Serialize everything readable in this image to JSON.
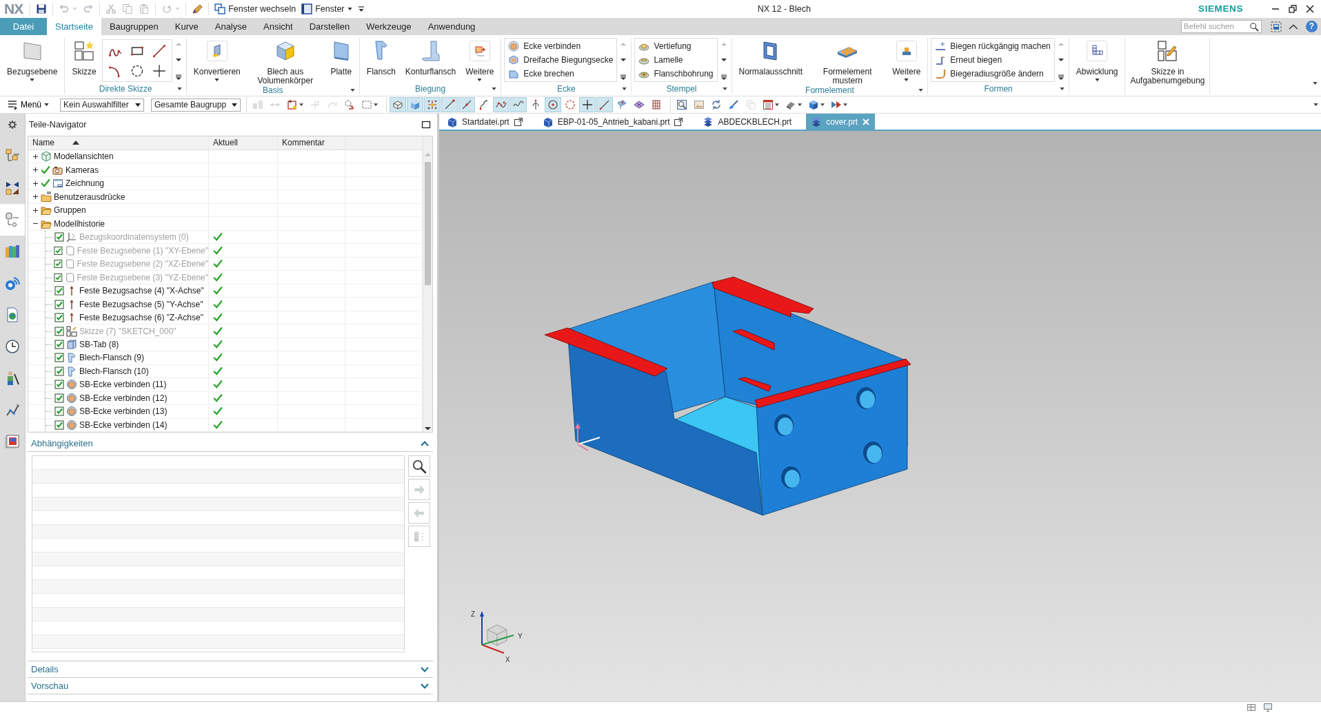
{
  "title_bar": {
    "logo": "NX",
    "quick_access": [
      [
        {
          "kind": "save",
          "disabled": false
        }
      ],
      [
        {
          "kind": "undo",
          "disabled": true,
          "dropdown": true
        },
        {
          "kind": "redo",
          "disabled": true
        }
      ],
      [
        {
          "kind": "cut",
          "disabled": true
        },
        {
          "kind": "copy",
          "disabled": true
        },
        {
          "kind": "paste",
          "disabled": true
        }
      ],
      [
        {
          "kind": "repeat",
          "disabled": true,
          "dropdown": true
        }
      ],
      [
        {
          "kind": "touch",
          "disabled": false
        }
      ],
      [
        {
          "kind": "switch-window",
          "disabled": false,
          "label": "Fenster wechseln"
        },
        {
          "kind": "window",
          "disabled": false,
          "label": "Fenster",
          "dropdown": true
        },
        {
          "kind": "customize",
          "disabled": false
        }
      ]
    ],
    "title": "NX 12 - Blech",
    "brand": "SIEMENS"
  },
  "menu_tabs": {
    "file_tab": "Datei",
    "tabs": [
      {
        "label": "Startseite",
        "selected": true
      },
      {
        "label": "Baugruppen",
        "selected": false
      },
      {
        "label": "Kurve",
        "selected": false
      },
      {
        "label": "Analyse",
        "selected": false
      },
      {
        "label": "Ansicht",
        "selected": false
      },
      {
        "label": "Darstellen",
        "selected": false
      },
      {
        "label": "Werkzeuge",
        "selected": false
      },
      {
        "label": "Anwendung",
        "selected": false
      }
    ],
    "command_search": {
      "placeholder": "Befehl suchen"
    },
    "help": "?"
  },
  "ribbon": [
    {
      "buttons": [
        {
          "kind": "datum-plane",
          "label": "Bezugsebene",
          "dropdown": true
        }
      ]
    },
    {
      "label": "Direkte Skizze",
      "options_menu": true,
      "buttons": [
        {
          "kind": "sketch",
          "label": "Skizze"
        }
      ],
      "sketch_tools": [
        {
          "kind": "spline"
        },
        {
          "kind": "rectangle"
        },
        {
          "kind": "straight-line"
        },
        {
          "kind": "arc"
        },
        {
          "kind": "circle"
        },
        {
          "kind": "point"
        }
      ]
    },
    {
      "label": "Basis",
      "options_menu": true,
      "buttons": [
        {
          "kind": "convert",
          "label": "Konvertieren",
          "dropdown": true
        },
        {
          "kind": "solid-to-sheet",
          "label": "Blech aus Volumenkörper"
        },
        {
          "kind": "plate",
          "label": "Platte"
        }
      ]
    },
    {
      "label": "Biegung",
      "options_menu": true,
      "buttons": [
        {
          "kind": "flange",
          "label": "Flansch"
        },
        {
          "kind": "contour-flange",
          "label": "Konturflansch"
        },
        {
          "kind": "bend-gallery",
          "label": "Weitere",
          "dropdown": true
        }
      ]
    },
    {
      "label": "Ecke",
      "options_menu": true,
      "entries": [
        {
          "kind": "closed-corner",
          "label": "Ecke verbinden"
        },
        {
          "kind": "three-bend-corner",
          "label": "Dreifache Biegungsecke"
        },
        {
          "kind": "break-corner",
          "label": "Ecke brechen"
        }
      ]
    },
    {
      "label": "Stempel",
      "options_menu": true,
      "entries": [
        {
          "kind": "dimple",
          "label": "Vertiefung"
        },
        {
          "kind": "louver",
          "label": "Lamelle"
        },
        {
          "kind": "drawn-cutout",
          "label": "Flanschbohrung"
        }
      ]
    },
    {
      "label": "Formelement",
      "options_menu": true,
      "buttons": [
        {
          "kind": "cutout",
          "label": "Normalausschnitt"
        },
        {
          "kind": "pattern",
          "label": "Formelement mustern"
        },
        {
          "kind": "feature-gallery",
          "label": "Weitere",
          "dropdown": true
        }
      ]
    },
    {
      "label": "Formen",
      "options_menu": true,
      "entries": [
        {
          "kind": "unbend",
          "label": "Biegen rückgängig machen"
        },
        {
          "kind": "rebend",
          "label": "Erneut biegen"
        },
        {
          "kind": "resize-radius",
          "label": "Biegeradiusgröße ändern"
        }
      ]
    },
    {
      "buttons": [
        {
          "kind": "flat-pattern",
          "label": "Abwicklung",
          "dropdown": true
        }
      ]
    },
    {
      "buttons": [
        {
          "kind": "sketch-in-task",
          "label": "Skizze in Aufgabenumgebung"
        }
      ]
    }
  ],
  "toolbar": {
    "menu": "Menü",
    "selection_filter": "Kein Auswahlfilter",
    "scope": "Gesamte Baugrupp",
    "tools": [
      [
        {
          "kind": "part-filter",
          "on": false,
          "disabled": true
        },
        {
          "kind": "pointer",
          "on": false,
          "disabled": true
        },
        {
          "kind": "color-select",
          "on": false,
          "disabled": false,
          "dropdown": true
        },
        {
          "kind": "snap-plus",
          "on": false,
          "disabled": true
        },
        {
          "kind": "curve-arrow",
          "on": false,
          "disabled": true
        },
        {
          "kind": "select-all",
          "on": false,
          "disabled": false
        },
        {
          "kind": "box-select",
          "on": false,
          "disabled": false,
          "dropdown": true
        }
      ],
      [
        {
          "kind": "view-outline",
          "on": true,
          "disabled": false
        },
        {
          "kind": "cube",
          "on": true,
          "disabled": false
        },
        {
          "kind": "snap-points",
          "on": true,
          "disabled": false
        },
        {
          "kind": "end-point",
          "on": true,
          "disabled": false
        },
        {
          "kind": "mid-point",
          "on": true,
          "disabled": false
        },
        {
          "kind": "curve-point",
          "on": false,
          "disabled": false
        },
        {
          "kind": "spline-points",
          "on": true,
          "disabled": false
        },
        {
          "kind": "wave",
          "on": true,
          "disabled": false
        },
        {
          "kind": "axis",
          "on": false,
          "disabled": false
        },
        {
          "kind": "center",
          "on": true,
          "disabled": false
        },
        {
          "kind": "quadrant",
          "on": false,
          "disabled": false
        },
        {
          "kind": "cross",
          "on": true,
          "disabled": false
        },
        {
          "kind": "line",
          "on": true,
          "disabled": false
        },
        {
          "kind": "face",
          "on": false,
          "disabled": false
        },
        {
          "kind": "mesh",
          "on": false,
          "disabled": false
        },
        {
          "kind": "grid",
          "on": false,
          "disabled": false
        }
      ],
      [
        {
          "kind": "zoom-window",
          "on": false,
          "disabled": false
        },
        {
          "kind": "image",
          "on": false,
          "disabled": false
        },
        {
          "kind": "rotate",
          "on": false,
          "disabled": false
        },
        {
          "kind": "brush",
          "on": false,
          "disabled": false
        },
        {
          "kind": "layers",
          "on": false,
          "disabled": true
        },
        {
          "kind": "layout",
          "on": false,
          "disabled": false,
          "dropdown": true
        },
        {
          "kind": "shade",
          "on": false,
          "disabled": false,
          "dropdown": true
        },
        {
          "kind": "solid",
          "on": false,
          "disabled": false,
          "dropdown": true
        },
        {
          "kind": "views",
          "on": false,
          "disabled": false,
          "dropdown": true
        }
      ]
    ]
  },
  "resource_bar": [
    {
      "kind": "settings",
      "selected": false
    },
    {
      "kind": "assembly-navigator",
      "selected": false
    },
    {
      "kind": "constraint-navigator",
      "selected": false
    },
    {
      "kind": "part-navigator",
      "selected": true
    },
    {
      "kind": "reuse-library",
      "selected": false
    },
    {
      "kind": "hd3d",
      "selected": false
    },
    {
      "kind": "web-browser",
      "selected": false
    },
    {
      "kind": "history",
      "selected": false
    },
    {
      "kind": "roles",
      "selected": false
    },
    {
      "kind": "process-studio",
      "selected": false
    },
    {
      "kind": "visualization",
      "selected": false
    }
  ],
  "navigator": {
    "title": "Teile-Navigator",
    "columns": [
      {
        "label": "Name",
        "sorted": true
      },
      {
        "label": "Aktuell",
        "sorted": false
      },
      {
        "label": "Kommentar",
        "sorted": false
      }
    ],
    "tree": [
      {
        "label": "Modellansichten",
        "kind": "views",
        "expanded": false,
        "checked": false
      },
      {
        "label": "Kameras",
        "kind": "cameras",
        "expanded": false,
        "checked": true
      },
      {
        "label": "Zeichnung",
        "kind": "drawing",
        "expanded": false,
        "checked": true
      },
      {
        "label": "Benutzerausdrücke",
        "kind": "expressions",
        "expanded": false,
        "checked": false
      },
      {
        "label": "Gruppen",
        "kind": "folder",
        "expanded": false,
        "checked": false
      },
      {
        "label": "Modellhistorie",
        "kind": "folder",
        "expanded": true,
        "checked": false,
        "children": [
          {
            "label": "Bezugskoordinatensystem (0)",
            "kind": "csys",
            "checked": true,
            "dimmed": true,
            "current": true
          },
          {
            "label": "Feste Bezugsebene (1) \"XY-Ebene\"",
            "kind": "plane",
            "checked": true,
            "dimmed": true,
            "current": true
          },
          {
            "label": "Feste Bezugsebene (2) \"XZ-Ebene\"",
            "kind": "plane",
            "checked": true,
            "dimmed": true,
            "current": true
          },
          {
            "label": "Feste Bezugsebene (3) \"YZ-Ebene\"",
            "kind": "plane",
            "checked": true,
            "dimmed": true,
            "current": true
          },
          {
            "label": "Feste Bezugsachse (4) \"X-Achse\"",
            "kind": "axis",
            "checked": true,
            "dimmed": false,
            "current": true
          },
          {
            "label": "Feste Bezugsachse (5) \"Y-Achse\"",
            "kind": "axis",
            "checked": true,
            "dimmed": false,
            "current": true
          },
          {
            "label": "Feste Bezugsachse (6) \"Z-Achse\"",
            "kind": "axis",
            "checked": true,
            "dimmed": false,
            "current": true
          },
          {
            "label": "Skizze (7) \"SKETCH_000\"",
            "kind": "sketch-feature",
            "checked": true,
            "dimmed": true,
            "current": true
          },
          {
            "label": "SB-Tab (8)",
            "kind": "tab",
            "checked": true,
            "dimmed": false,
            "current": true
          },
          {
            "label": "Blech-Flansch (9)",
            "kind": "sheet-flange",
            "checked": true,
            "dimmed": false,
            "current": true
          },
          {
            "label": "Blech-Flansch (10)",
            "kind": "sheet-flange",
            "checked": true,
            "dimmed": false,
            "current": true
          },
          {
            "label": "SB-Ecke verbinden (11)",
            "kind": "corner",
            "checked": true,
            "dimmed": false,
            "current": true
          },
          {
            "label": "SB-Ecke verbinden (12)",
            "kind": "corner",
            "checked": true,
            "dimmed": false,
            "current": true
          },
          {
            "label": "SB-Ecke verbinden (13)",
            "kind": "corner",
            "checked": true,
            "dimmed": false,
            "current": true
          },
          {
            "label": "SB-Ecke verbinden (14)",
            "kind": "corner",
            "checked": true,
            "dimmed": false,
            "current": true
          }
        ]
      }
    ]
  },
  "panels": [
    {
      "title": "Abhängigkeiten",
      "expanded": true,
      "tools": [
        {
          "kind": "search",
          "disabled": false
        },
        {
          "kind": "forward",
          "disabled": true
        },
        {
          "kind": "back",
          "disabled": true
        },
        {
          "kind": "options",
          "disabled": true
        }
      ]
    },
    {
      "title": "Details",
      "expanded": false
    },
    {
      "title": "Vorschau",
      "expanded": false
    }
  ],
  "documents": [
    {
      "label": "Startdatei.prt",
      "kind": "part",
      "selected": false,
      "popout": true
    },
    {
      "label": "EBP-01-05_Antrieb_kabani.prt",
      "kind": "part",
      "selected": false,
      "popout": true
    },
    {
      "label": "ABDECKBLECH.prt",
      "kind": "sheet-metal",
      "selected": false
    },
    {
      "label": "cover.prt",
      "kind": "sheet-metal",
      "selected": true
    }
  ],
  "viewport": {
    "view_triad": [
      "Z",
      "Y",
      "X"
    ]
  }
}
